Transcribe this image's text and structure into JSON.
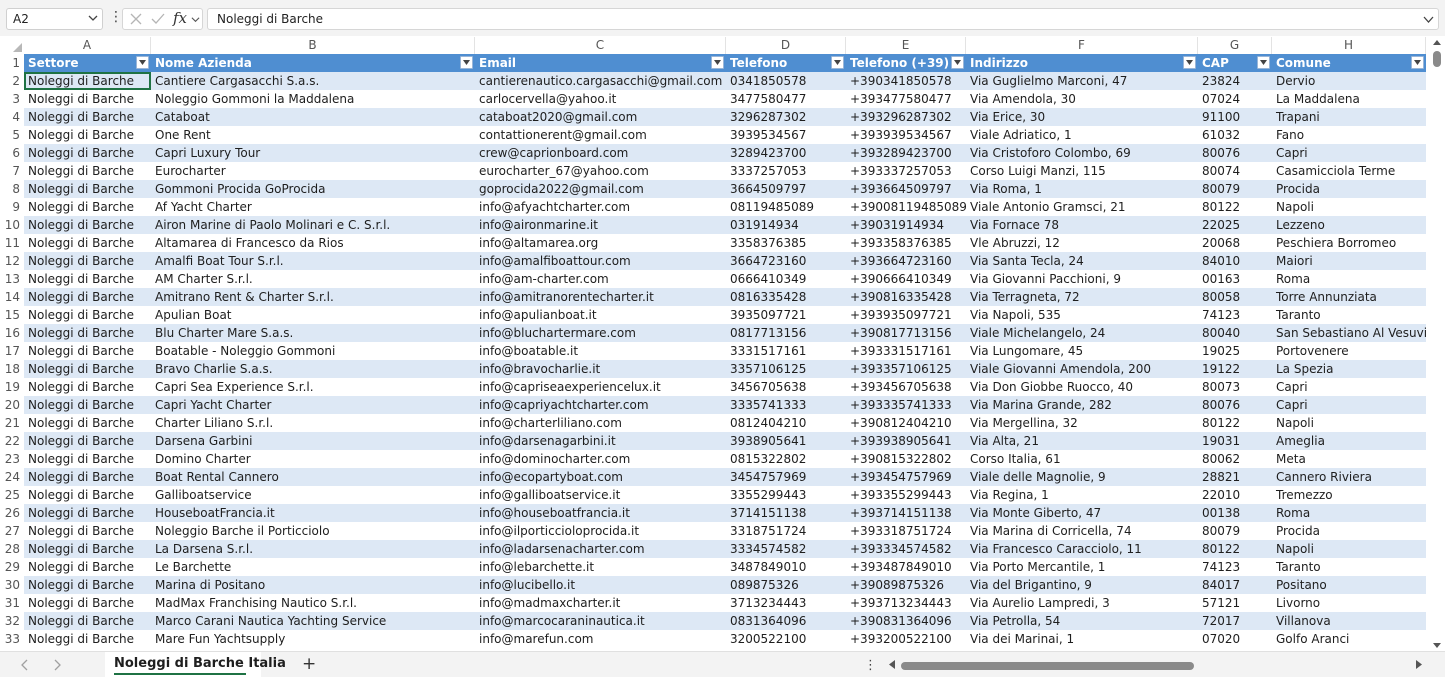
{
  "formula_bar": {
    "name_box": "A2",
    "formula": "Noleggi di Barche",
    "fx_label": "fx"
  },
  "columns": [
    "A",
    "B",
    "C",
    "D",
    "E",
    "F",
    "G",
    "H"
  ],
  "header": [
    "Settore",
    "Nome Azienda",
    "Email",
    "Telefono",
    "Telefono (+39)",
    "Indirizzo",
    "CAP",
    "Comune"
  ],
  "header_row_number": "1",
  "rows": [
    [
      "2",
      "Noleggi di Barche",
      "Cantiere Cargasacchi S.a.s.",
      "cantierenautico.cargasacchi@gmail.com",
      "0341850578",
      "+390341850578",
      "Via Guglielmo Marconi, 47",
      "23824",
      "Dervio"
    ],
    [
      "3",
      "Noleggi di Barche",
      "Noleggio Gommoni la Maddalena",
      "carlocervella@yahoo.it",
      "3477580477",
      "+393477580477",
      "Via Amendola, 30",
      "07024",
      "La Maddalena"
    ],
    [
      "4",
      "Noleggi di Barche",
      "Cataboat",
      "cataboat2020@gmail.com",
      "3296287302",
      "+393296287302",
      "Via Erice, 30",
      "91100",
      "Trapani"
    ],
    [
      "5",
      "Noleggi di Barche",
      "One Rent",
      "contattionerent@gmail.com",
      "3939534567",
      "+393939534567",
      "Viale Adriatico, 1",
      "61032",
      "Fano"
    ],
    [
      "6",
      "Noleggi di Barche",
      "Capri Luxury Tour",
      "crew@caprionboard.com",
      "3289423700",
      "+393289423700",
      "Via Cristoforo Colombo, 69",
      "80076",
      "Capri"
    ],
    [
      "7",
      "Noleggi di Barche",
      "Eurocharter",
      "eurocharter_67@yahoo.com",
      "3337257053",
      "+393337257053",
      "Corso Luigi Manzi, 115",
      "80074",
      "Casamicciola Terme"
    ],
    [
      "8",
      "Noleggi di Barche",
      "Gommoni Procida GoProcida",
      "goprocida2022@gmail.com",
      "3664509797",
      "+393664509797",
      "Via Roma, 1",
      "80079",
      "Procida"
    ],
    [
      "9",
      "Noleggi di Barche",
      "Af Yacht Charter",
      "info@afyachtcharter.com",
      "08119485089",
      "+39008119485089",
      "Viale Antonio Gramsci, 21",
      "80122",
      "Napoli"
    ],
    [
      "10",
      "Noleggi di Barche",
      "Airon Marine di Paolo Molinari e C. S.r.l.",
      "info@aironmarine.it",
      "031914934",
      "+39031914934",
      "Via Fornace 78",
      "22025",
      "Lezzeno"
    ],
    [
      "11",
      "Noleggi di Barche",
      "Altamarea di Francesco da Rios",
      "info@altamarea.org",
      "3358376385",
      "+393358376385",
      "Vle Abruzzi, 12",
      "20068",
      "Peschiera Borromeo"
    ],
    [
      "12",
      "Noleggi di Barche",
      "Amalfi Boat Tour S.r.l.",
      "info@amalfiboattour.com",
      "3664723160",
      "+393664723160",
      "Via Santa Tecla, 24",
      "84010",
      "Maiori"
    ],
    [
      "13",
      "Noleggi di Barche",
      "AM Charter S.r.l.",
      "info@am-charter.com",
      "0666410349",
      "+390666410349",
      "Via Giovanni Pacchioni, 9",
      "00163",
      "Roma"
    ],
    [
      "14",
      "Noleggi di Barche",
      "Amitrano Rent & Charter S.r.l.",
      "info@amitranorentecharter.it",
      "0816335428",
      "+390816335428",
      "Via Terragneta, 72",
      "80058",
      "Torre Annunziata"
    ],
    [
      "15",
      "Noleggi di Barche",
      "Apulian Boat",
      "info@apulianboat.it",
      "3935097721",
      "+393935097721",
      "Via Napoli, 535",
      "74123",
      "Taranto"
    ],
    [
      "16",
      "Noleggi di Barche",
      "Blu Charter Mare S.a.s.",
      "info@bluchartermare.com",
      "0817713156",
      "+390817713156",
      "Viale Michelangelo, 24",
      "80040",
      "San Sebastiano Al Vesuvio"
    ],
    [
      "17",
      "Noleggi di Barche",
      "Boatable - Noleggio Gommoni",
      "info@boatable.it",
      "3331517161",
      "+393331517161",
      "Via Lungomare, 45",
      "19025",
      "Portovenere"
    ],
    [
      "18",
      "Noleggi di Barche",
      "Bravo Charlie S.a.s.",
      "info@bravocharlie.it",
      "3357106125",
      "+393357106125",
      "Viale Giovanni Amendola, 200",
      "19122",
      "La Spezia"
    ],
    [
      "19",
      "Noleggi di Barche",
      "Capri Sea Experience S.r.l.",
      "info@capriseaexperiencelux.it",
      "3456705638",
      "+393456705638",
      "Via Don Giobbe Ruocco, 40",
      "80073",
      "Capri"
    ],
    [
      "20",
      "Noleggi di Barche",
      "Capri Yacht Charter",
      "info@capriyachtcharter.com",
      "3335741333",
      "+393335741333",
      "Via Marina Grande, 282",
      "80076",
      "Capri"
    ],
    [
      "21",
      "Noleggi di Barche",
      "Charter Liliano S.r.l.",
      "info@charterliliano.com",
      "0812404210",
      "+390812404210",
      "Via Mergellina, 32",
      "80122",
      "Napoli"
    ],
    [
      "22",
      "Noleggi di Barche",
      "Darsena Garbini",
      "info@darsenagarbini.it",
      "3938905641",
      "+393938905641",
      "Via Alta, 21",
      "19031",
      "Ameglia"
    ],
    [
      "23",
      "Noleggi di Barche",
      "Domino Charter",
      "info@dominocharter.com",
      "0815322802",
      "+390815322802",
      "Corso Italia, 61",
      "80062",
      "Meta"
    ],
    [
      "24",
      "Noleggi di Barche",
      "Boat Rental Cannero",
      "info@ecopartyboat.com",
      "3454757969",
      "+393454757969",
      "Viale delle Magnolie, 9",
      "28821",
      "Cannero Riviera"
    ],
    [
      "25",
      "Noleggi di Barche",
      "Galliboatservice",
      "info@galliboatservice.it",
      "3355299443",
      "+393355299443",
      "Via Regina, 1",
      "22010",
      "Tremezzo"
    ],
    [
      "26",
      "Noleggi di Barche",
      "HouseboatFrancia.it",
      "info@houseboatfrancia.it",
      "3714151138",
      "+393714151138",
      "Via Monte Giberto, 47",
      "00138",
      "Roma"
    ],
    [
      "27",
      "Noleggi di Barche",
      "Noleggio Barche il Porticciolo",
      "info@ilporticcioloprocida.it",
      "3318751724",
      "+393318751724",
      "Via Marina di Corricella, 74",
      "80079",
      "Procida"
    ],
    [
      "28",
      "Noleggi di Barche",
      "La Darsena S.r.l.",
      "info@ladarsenacharter.com",
      "3334574582",
      "+393334574582",
      "Via Francesco Caracciolo, 11",
      "80122",
      "Napoli"
    ],
    [
      "29",
      "Noleggi di Barche",
      "Le Barchette",
      "info@lebarchette.it",
      "3487849010",
      "+393487849010",
      "Via Porto Mercantile, 1",
      "74123",
      "Taranto"
    ],
    [
      "30",
      "Noleggi di Barche",
      "Marina di Positano",
      "info@lucibello.it",
      "089875326",
      "+39089875326",
      "Via del Brigantino, 9",
      "84017",
      "Positano"
    ],
    [
      "31",
      "Noleggi di Barche",
      "MadMax Franchising Nautico S.r.l.",
      "info@madmaxcharter.it",
      "3713234443",
      "+393713234443",
      "Via Aurelio Lampredi, 3",
      "57121",
      "Livorno"
    ],
    [
      "32",
      "Noleggi di Barche",
      "Marco Carani Nautica Yachting Service",
      "info@marcocaraninautica.it",
      "0831364096",
      "+390831364096",
      "Via Petrolla, 54",
      "72017",
      "Villanova"
    ],
    [
      "33",
      "Noleggi di Barche",
      "Mare Fun Yachtsupply",
      "info@marefun.com",
      "3200522100",
      "+393200522100",
      "Via dei Marinai, 1",
      "07020",
      "Golfo Aranci"
    ]
  ],
  "sheet_tab": {
    "label": "Noleggi di Barche Italia"
  },
  "add_sheet": "+",
  "colors": {
    "header_fill": "#4f8ed1",
    "band_fill": "#dde8f5",
    "selection": "#1f7244"
  }
}
